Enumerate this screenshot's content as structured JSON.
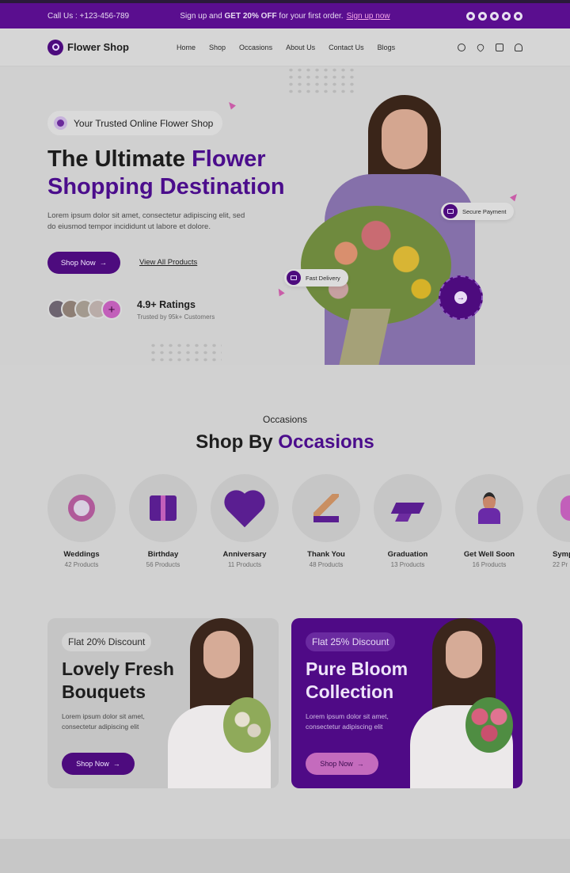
{
  "topbar": {
    "call": "Call Us : +123-456-789",
    "promo_pre": "Sign up and ",
    "promo_bold": "GET 20% OFF",
    "promo_post": " for your first order.",
    "promo_link": "Sign up now",
    "social": [
      "facebook-icon",
      "x-icon",
      "pinterest-icon",
      "instagram-icon",
      "youtube-icon"
    ]
  },
  "nav": {
    "brand": "Flower Shop",
    "items": [
      "Home",
      "Shop",
      "Occasions",
      "About Us",
      "Contact Us",
      "Blogs"
    ],
    "icons": [
      "search-icon",
      "heart-icon",
      "bag-icon",
      "user-icon"
    ]
  },
  "hero": {
    "badge": "Your Trusted Online Flower Shop",
    "title_plain": "The Ultimate ",
    "title_accent": "Flower Shopping Destination",
    "lead": "Lorem ipsum dolor sit amet, consectetur adipiscing elit, sed do eiusmod tempor incididunt ut labore et dolore.",
    "cta": "Shop Now",
    "secondary": "View All Products",
    "rating": "4.9+ Ratings",
    "rating_sub": "Trusted by 95k+ Customers",
    "pill_payment": "Secure Payment",
    "pill_delivery": "Fast Delivery"
  },
  "occasions": {
    "tag": "Occasions",
    "title_plain": "Shop By ",
    "title_accent": "Occasions",
    "items": [
      {
        "name": "Weddings",
        "count": "42 Products"
      },
      {
        "name": "Birthday",
        "count": "56 Products"
      },
      {
        "name": "Anniversary",
        "count": "11 Products"
      },
      {
        "name": "Thank You",
        "count": "48 Products"
      },
      {
        "name": "Graduation",
        "count": "13 Products"
      },
      {
        "name": "Get Well Soon",
        "count": "16 Products"
      },
      {
        "name": "Symp",
        "count": "22 Pr"
      }
    ]
  },
  "promos": [
    {
      "tag": "Flat 20% Discount",
      "title": "Lovely Fresh Bouquets",
      "text": "Lorem ipsum dolor sit amet, consectetur adipiscing elit",
      "cta": "Shop Now"
    },
    {
      "tag": "Flat 25% Discount",
      "title": "Pure Bloom Collection",
      "text": "Lorem ipsum dolor sit amet, consectetur adipiscing elit",
      "cta": "Shop Now"
    }
  ],
  "colors": {
    "brand": "#4d0b7e",
    "accent": "#c25fba",
    "topbar": "#5a0e8f"
  }
}
